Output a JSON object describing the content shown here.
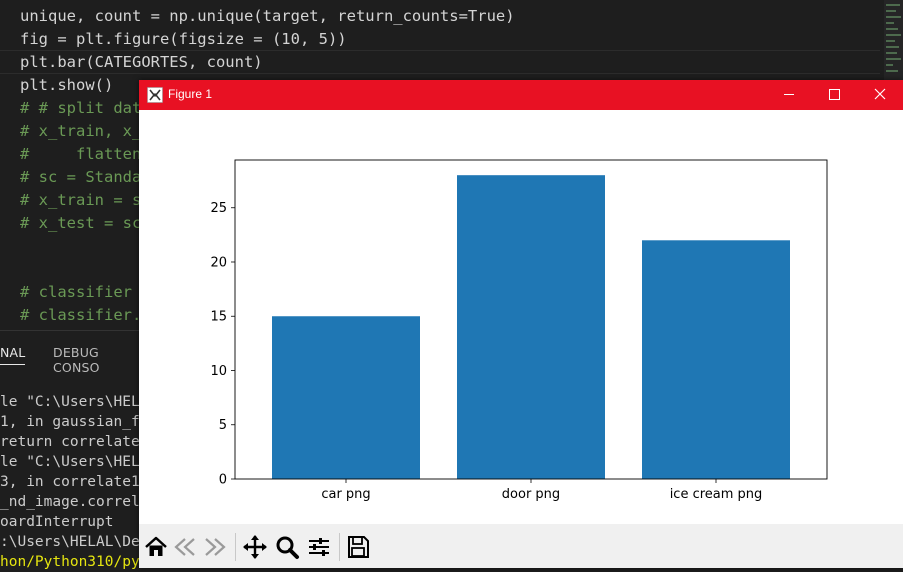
{
  "editor": {
    "lines": [
      {
        "text": "unique, count = np.unique(target, return_counts=True)",
        "comment": false
      },
      {
        "text": "fig = plt.figure(figsize = (10, 5))",
        "comment": false
      },
      {
        "text": "plt.bar(CATEGORTES, count)",
        "comment": false
      },
      {
        "text": "plt.show()",
        "comment": false
      },
      {
        "text": "# # split dat",
        "comment": true
      },
      {
        "text": "# x_train, x_",
        "comment": true
      },
      {
        "text": "#     flatten",
        "comment": true
      },
      {
        "text": "# sc = Standa",
        "comment": true
      },
      {
        "text": "# x_train = s",
        "comment": true
      },
      {
        "text": "# x_test = sc",
        "comment": true
      },
      {
        "text": "",
        "comment": false
      },
      {
        "text": "",
        "comment": false
      },
      {
        "text": "# classifier ",
        "comment": true
      },
      {
        "text": "# classifier.",
        "comment": true
      }
    ]
  },
  "panel": {
    "tabs": [
      {
        "label": "NAL",
        "active": true
      },
      {
        "label": "DEBUG CONSO",
        "active": false
      }
    ],
    "terminal_lines": [
      {
        "text": "le \"C:\\Users\\HEL",
        "yellow": false
      },
      {
        "text": "1, in gaussian_f",
        "yellow": false
      },
      {
        "text": "return correlate",
        "yellow": false
      },
      {
        "text": "le \"C:\\Users\\HEL",
        "yellow": false
      },
      {
        "text": "3, in correlate1",
        "yellow": false
      },
      {
        "text": "_nd_image.correl",
        "yellow": false
      },
      {
        "text": "oardInterrupt",
        "yellow": false
      },
      {
        "text": ":\\Users\\HELAL\\De",
        "yellow": false
      },
      {
        "text": "hon/Python310/py",
        "yellow": true
      }
    ]
  },
  "figure_window": {
    "title": "Figure 1",
    "icons": {
      "app": "matplotlib-figure-icon",
      "minimize": "minimize-icon",
      "maximize": "maximize-icon",
      "close": "close-icon"
    },
    "toolbar": [
      {
        "name": "home-icon"
      },
      {
        "name": "back-arrow-icon"
      },
      {
        "name": "forward-arrow-icon"
      },
      {
        "name": "pan-icon"
      },
      {
        "name": "zoom-icon"
      },
      {
        "name": "configure-subplots-icon"
      },
      {
        "name": "save-icon"
      }
    ],
    "titlebar_color": "#e81123"
  },
  "chart_data": {
    "type": "bar",
    "categories": [
      "car png",
      "door png",
      "ice cream png"
    ],
    "values": [
      15,
      28,
      22
    ],
    "yticks": [
      "0",
      "5",
      "10",
      "15",
      "20",
      "25"
    ],
    "ylim": [
      0,
      29.4
    ],
    "bar_color": "#1f77b4",
    "grid": false
  }
}
